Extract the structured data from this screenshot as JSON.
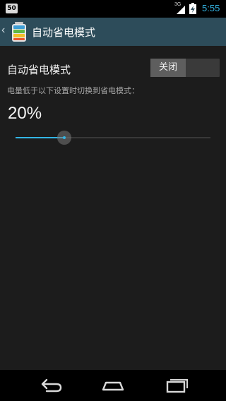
{
  "status_bar": {
    "notification_count": "50",
    "network_label": "3G",
    "time": "5:55",
    "icons": [
      "signal-icon",
      "battery-charging-icon"
    ]
  },
  "action_bar": {
    "back_glyph": "‹",
    "title": "自动省电模式",
    "icon": "battery-app-icon"
  },
  "setting": {
    "title": "自动省电模式",
    "toggle_label": "关闭",
    "toggle_on": false,
    "description": "电量低于以下设置时切换到省电模式：",
    "threshold_text": "20%",
    "threshold_value": 0.25
  },
  "nav_bar": {
    "icons": [
      "back-icon",
      "home-icon",
      "recent-apps-icon"
    ]
  },
  "colors": {
    "accent": "#33b5e5",
    "action_bar": "#2d4c5a",
    "background": "#1c1c1c"
  }
}
